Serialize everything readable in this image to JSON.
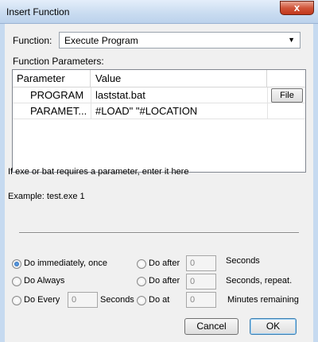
{
  "window": {
    "title": "Insert Function",
    "close_label": "x"
  },
  "function": {
    "label": "Function:",
    "value": "Execute Program",
    "arrow": "▼"
  },
  "params": {
    "label": "Function Parameters:",
    "columns": [
      "Parameter",
      "Value"
    ],
    "rows": [
      {
        "name": "PROGRAM",
        "value": "laststat.bat",
        "button": "File"
      },
      {
        "name": "PARAMET...",
        "value": "#LOAD\" \"#LOCATION"
      }
    ]
  },
  "hint": "If exe or bat requires a parameter, enter it here",
  "example": "Example: test.exe 1",
  "schedule": {
    "immediate": "Do immediately, once",
    "always": "Do Always",
    "every": "Do Every",
    "every_value": "0",
    "every_unit": "Seconds",
    "after1": "Do after",
    "after1_value": "0",
    "after1_unit": "Seconds",
    "after2": "Do after",
    "after2_value": "0",
    "after2_unit": "Seconds, repeat.",
    "at": "Do at",
    "at_value": "0",
    "at_unit": "Minutes remaining"
  },
  "buttons": {
    "cancel": "Cancel",
    "ok": "OK"
  }
}
